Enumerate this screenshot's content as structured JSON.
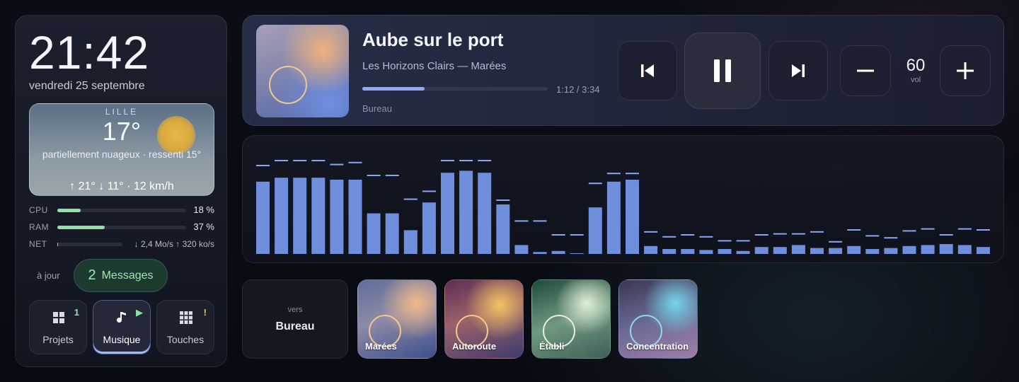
{
  "status": {
    "time": "21:42",
    "date": "vendredi 25 septembre"
  },
  "weather": {
    "city": "LILLE",
    "temp": "17°",
    "desc": "partiellement nuageux · ressenti 15°",
    "minmax": "↑ 21°  ↓ 11°  · 12 km/h"
  },
  "system": {
    "cpu": {
      "label": "CPU",
      "value": "18 %",
      "level": 0.18
    },
    "ram": {
      "label": "RAM",
      "value": "37 %",
      "level": 0.37
    },
    "net": {
      "label": "NET",
      "value": "↓ 2,4 Mo/s ↑ 320 ko/s",
      "level": 0.01
    }
  },
  "messages": {
    "status": "à jour",
    "count": "2",
    "label": "Messages"
  },
  "apps": [
    {
      "label": "Projets",
      "badge": "1",
      "badge_color": "#8fe3a5",
      "icon": "grid-icon"
    },
    {
      "label": "Musique",
      "badge": "▶",
      "badge_color": "#8fe3a5",
      "icon": "music-note-icon"
    },
    {
      "label": "Touches",
      "badge": "!",
      "badge_color": "#f2c94c",
      "icon": "keypad-icon"
    }
  ],
  "player": {
    "title": "Aube sur le port",
    "artist": "Les Horizons Clairs — Marées",
    "time": "1:12 / 3:34",
    "progress": 0.336,
    "room": "Bureau",
    "volume": "60",
    "volume_label": "vol"
  },
  "visualizer": {
    "bar_color": "#6f8edc",
    "peak_color": "#8aa6f0",
    "levels": [
      0.73,
      0.77,
      0.77,
      0.77,
      0.75,
      0.75,
      0.41,
      0.41,
      0.24,
      0.52,
      0.82,
      0.84,
      0.82,
      0.5,
      0.09,
      0.02,
      0.03,
      0.0,
      0.47,
      0.73,
      0.75,
      0.08,
      0.05,
      0.05,
      0.04,
      0.05,
      0.03,
      0.07,
      0.07,
      0.09,
      0.06,
      0.06,
      0.08,
      0.05,
      0.06,
      0.08,
      0.09,
      0.1,
      0.09,
      0.07
    ],
    "peaks": [
      0.9,
      0.95,
      0.95,
      0.95,
      0.91,
      0.93,
      0.8,
      0.8,
      0.56,
      0.64,
      0.95,
      0.95,
      0.95,
      0.55,
      0.34,
      0.34,
      0.2,
      0.2,
      0.72,
      0.82,
      0.82,
      0.23,
      0.18,
      0.2,
      0.18,
      0.14,
      0.14,
      0.2,
      0.21,
      0.21,
      0.23,
      0.13,
      0.25,
      0.19,
      0.17,
      0.24,
      0.26,
      0.2,
      0.26,
      0.25
    ]
  },
  "scenes": {
    "destination_prefix": "vers",
    "destination": "Bureau",
    "items": [
      "Marées",
      "Autoroute",
      "Établi",
      "Concentration"
    ]
  }
}
